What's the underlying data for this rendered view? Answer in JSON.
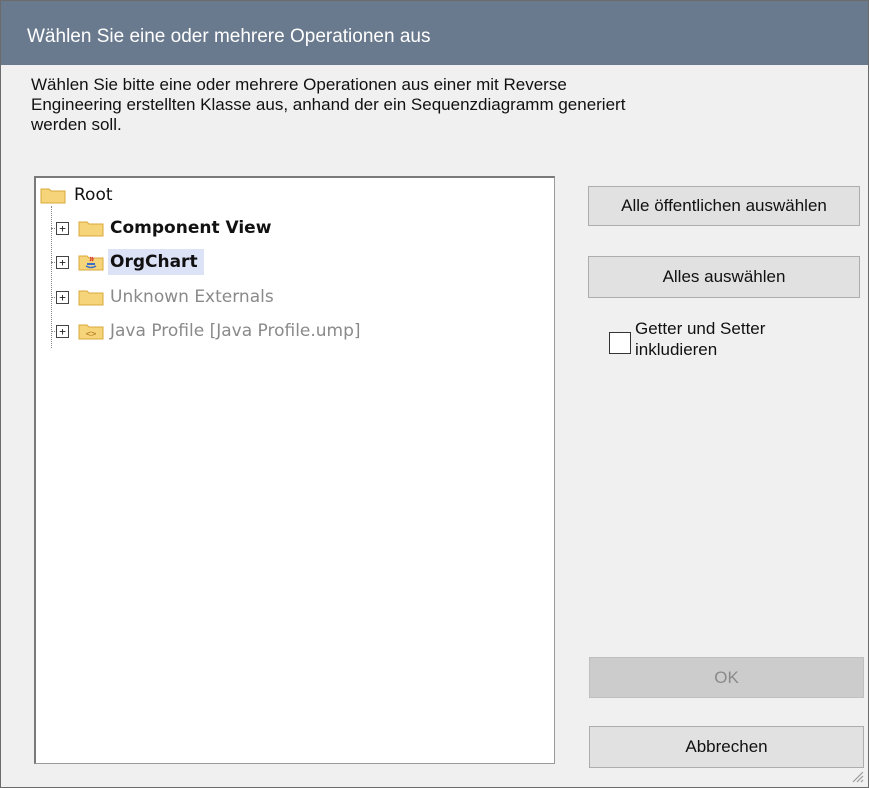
{
  "window": {
    "title": "Wählen Sie eine oder mehrere Operationen aus"
  },
  "description": {
    "line1": "Wählen Sie bitte eine oder mehrere Operationen aus einer mit Reverse",
    "line2": "Engineering erstellten Klasse aus, anhand der ein Sequenzdiagramm generiert",
    "line3": "werden soll."
  },
  "tree": {
    "root": {
      "label": "Root",
      "icon": "folder-icon"
    },
    "items": [
      {
        "label": "Component View",
        "icon": "folder-icon",
        "expander": "+",
        "state": "normal"
      },
      {
        "label": "OrgChart",
        "icon": "java-package-icon",
        "expander": "+",
        "state": "selected"
      },
      {
        "label": "Unknown Externals",
        "icon": "folder-icon",
        "expander": "+",
        "state": "disabled"
      },
      {
        "label": "Java Profile [Java Profile.ump]",
        "icon": "profile-package-icon",
        "expander": "+",
        "state": "disabled"
      }
    ]
  },
  "buttons": {
    "select_public": "Alle öffentlichen auswählen",
    "select_all": "Alles auswählen",
    "ok": "OK",
    "cancel": "Abbrechen"
  },
  "options": {
    "getters_setters_line1": "Getter und Setter",
    "getters_setters_line2": "inkludieren",
    "getters_setters_checked": false
  },
  "colors": {
    "titlebar": "#6a7a8e",
    "selection": "#dde3f6",
    "folder": "#f6d47a"
  }
}
